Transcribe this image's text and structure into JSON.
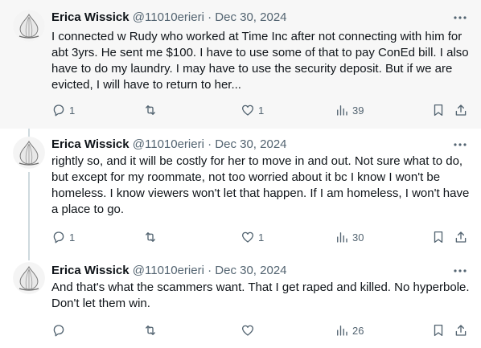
{
  "tweets": [
    {
      "author": "Erica Wissick",
      "handle": "@11010erieri",
      "separator": "·",
      "date": "Dec 30, 2024",
      "text": "I connected w Rudy who worked at Time Inc after not connecting with him for abt 3yrs. He sent me $100. I have to use some of that to pay ConEd bill. I also have to do my laundry. I may have to use the security deposit. But if we are evicted, I will have to return to her...",
      "replies": "1",
      "reposts": "",
      "likes": "1",
      "views": "39"
    },
    {
      "author": "Erica Wissick",
      "handle": "@11010erieri",
      "separator": "·",
      "date": "Dec 30, 2024",
      "text": "rightly so, and it will be costly for her to move in and out.  Not sure what to do, but except for my roommate, not too worried about it bc I know I won't be homeless. I know viewers won't let that happen. If I am homeless, I won't have a place to go.",
      "replies": "1",
      "reposts": "",
      "likes": "1",
      "views": "30"
    },
    {
      "author": "Erica Wissick",
      "handle": "@11010erieri",
      "separator": "·",
      "date": "Dec 30, 2024",
      "text": "And that's what the scammers want. That I get raped and killed. No hyperbole. Don't let them win.",
      "replies": "",
      "reposts": "",
      "likes": "",
      "views": "26"
    }
  ],
  "icons": {
    "more": "more-horizontal-icon",
    "reply": "reply-icon",
    "repost": "repost-icon",
    "like": "heart-icon",
    "views": "views-icon",
    "bookmark": "bookmark-icon",
    "share": "share-icon"
  },
  "colors": {
    "text": "#0f1419",
    "secondary": "#536471",
    "thread_line": "#cfd9de",
    "highlight_bg": "#f7f7f7"
  }
}
